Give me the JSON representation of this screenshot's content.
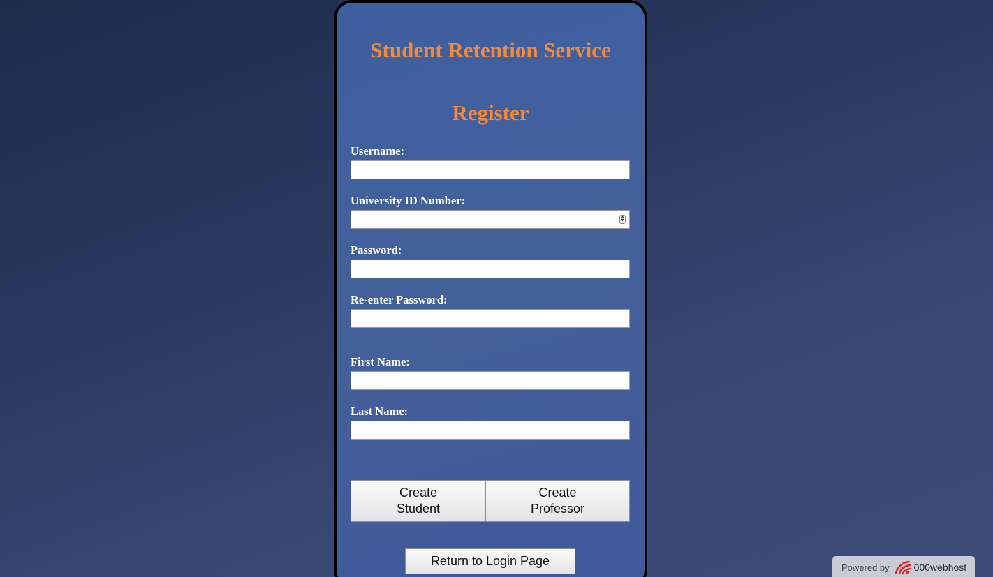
{
  "app": {
    "title": "Student Retention Service"
  },
  "form": {
    "heading": "Register",
    "fields": [
      {
        "label": "Username:",
        "value": "",
        "type": "text"
      },
      {
        "label": "University ID Number:",
        "value": "",
        "type": "number"
      },
      {
        "label": "Password:",
        "value": "",
        "type": "password"
      },
      {
        "label": "Re-enter Password:",
        "value": "",
        "type": "password"
      },
      {
        "label": "First Name:",
        "value": "",
        "type": "text"
      },
      {
        "label": "Last Name:",
        "value": "",
        "type": "text"
      }
    ],
    "buttons": {
      "create_student_line1": "Create",
      "create_student_line2": "Student",
      "create_professor_line1": "Create",
      "create_professor_line2": "Professor",
      "return_login": "Return to Login Page"
    }
  },
  "footer_badge": {
    "powered_by": "Powered by",
    "brand": "000webhost",
    "icon": "000webhost-logo-icon",
    "brand_color": "#e8202a"
  },
  "colors": {
    "heading": "#f4893a",
    "panel": "#42609c",
    "panel_border": "#000000",
    "label": "#ffffff"
  }
}
